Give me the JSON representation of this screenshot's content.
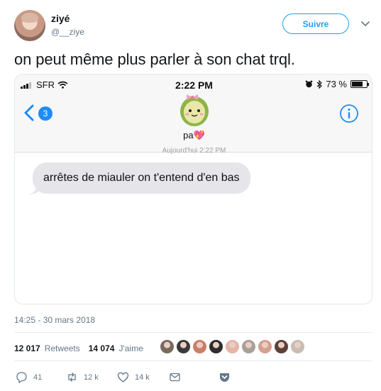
{
  "tweet": {
    "display_name": "ziyé",
    "handle": "@__ziye",
    "follow_label": "Suivre",
    "text": "on peut même plus parler à son chat trql.",
    "datetime": "14:25 - 30 mars 2018"
  },
  "screenshot": {
    "status_bar": {
      "carrier": "SFR",
      "time": "2:22 PM",
      "battery": "73 %"
    },
    "back_badge": "3",
    "contact_name": "pa",
    "contact_emoji": "💖",
    "timestamp_ghost": "Aujourd'hui 2:22 PM",
    "message": "arrêtes de miauler on t'entend d'en bas"
  },
  "stats": {
    "retweets_count": "12 017",
    "retweets_label": "Retweets",
    "likes_count": "14 074",
    "likes_label": "J'aime"
  },
  "actions": {
    "replies": "41",
    "retweets": "12 k",
    "likes": "14 k"
  },
  "colors": {
    "accent": "#1da1f2",
    "imessage_blue": "#1d8cf6",
    "bubble_gray": "#e5e5ea",
    "muted_text": "#657786"
  },
  "liker_avatars": [
    "#7a6a5e",
    "#3b3a3a",
    "#c97f6a",
    "#2d2d2d",
    "#e7b4a8",
    "#a99f9a",
    "#d4a090",
    "#5f3f3a",
    "#c8bdb4"
  ]
}
